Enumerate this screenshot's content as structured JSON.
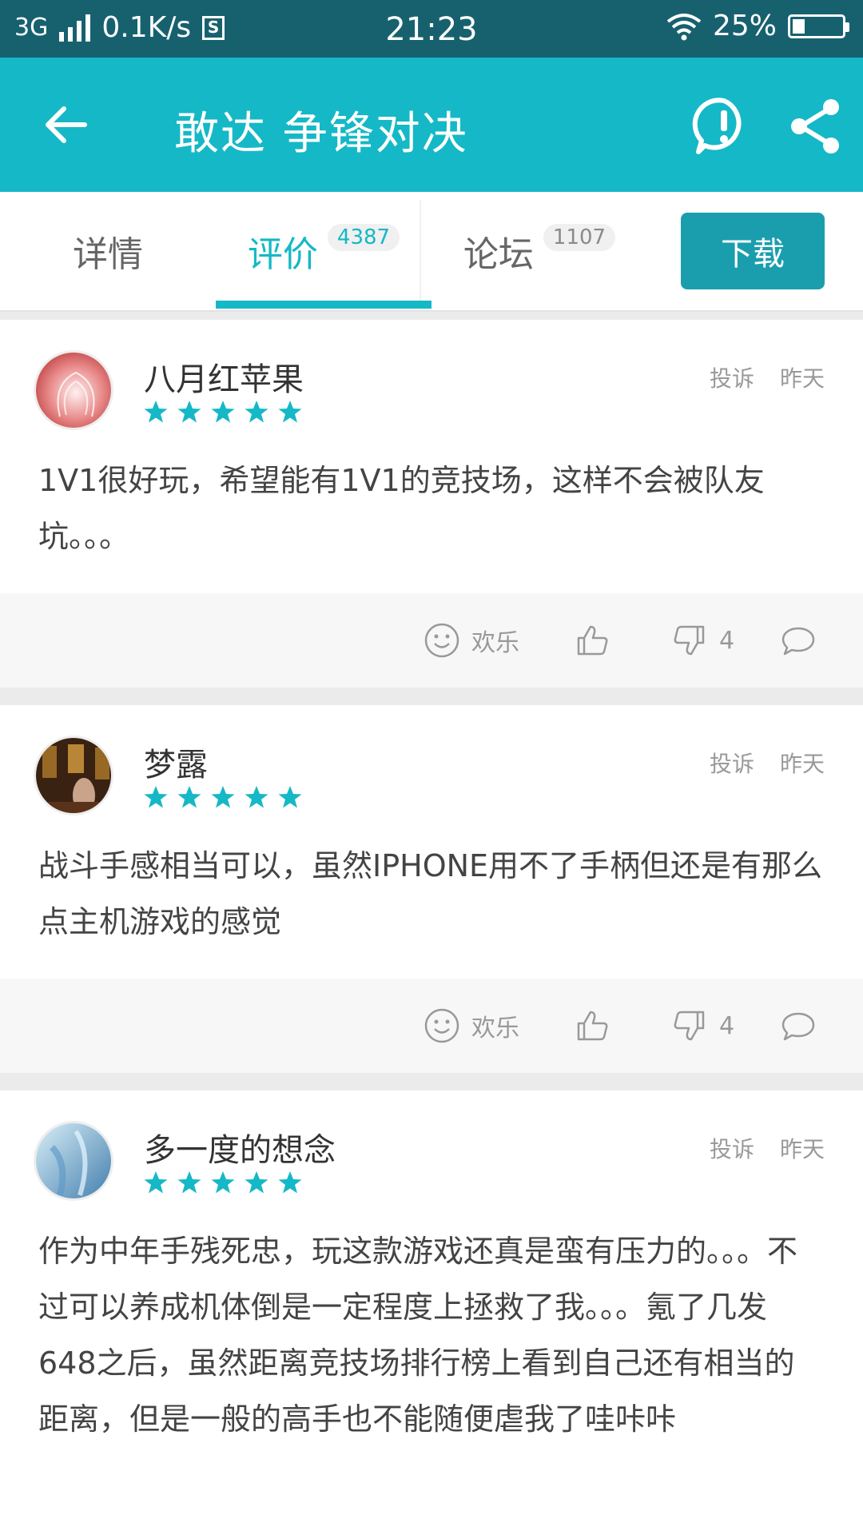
{
  "status_bar": {
    "network": "3G",
    "speed": "0.1K/s",
    "sim_icon": "S",
    "time": "21:23",
    "battery": "25%",
    "battery_level": 0.25
  },
  "app_bar": {
    "title": "敢达 争锋对决",
    "icons": [
      "back-arrow-icon",
      "report-icon",
      "share-icon"
    ]
  },
  "tabs": [
    {
      "label": "详情"
    },
    {
      "label": "评价",
      "count": "4387"
    },
    {
      "label": "论坛",
      "count": "1107"
    }
  ],
  "download_label": "下载",
  "colors": {
    "accent": "#15b8c6",
    "status_bar": "#17616f",
    "download": "#1a9eae"
  },
  "reviews": [
    {
      "user": "八月红苹果",
      "rating": 5,
      "report": "投诉",
      "time": "昨天",
      "text": "1V1很好玩，希望能有1V1的竞技场，这样不会被队友坑。。。",
      "mood": "欢乐",
      "downvotes": "4"
    },
    {
      "user": "梦露",
      "rating": 5,
      "report": "投诉",
      "time": "昨天",
      "text": "战斗手感相当可以，虽然IPHONE用不了手柄但还是有那么点主机游戏的感觉",
      "mood": "欢乐",
      "downvotes": "4"
    },
    {
      "user": "多一度的想念",
      "rating": 5,
      "report": "投诉",
      "time": "昨天",
      "text": "作为中年手残死忠，玩这款游戏还真是蛮有压力的。。。不过可以养成机体倒是一定程度上拯救了我。。。氪了几发648之后，虽然距离竞技场排行榜上看到自己还有相当的距离，但是一般的高手也不能随便虐我了哇咔咔"
    }
  ]
}
